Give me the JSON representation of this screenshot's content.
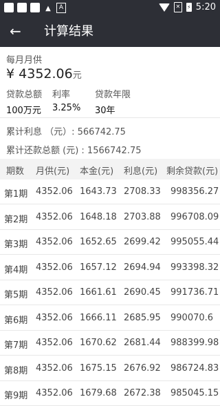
{
  "status": {
    "time": "5:20"
  },
  "appbar": {
    "title": "计算结果"
  },
  "summary": {
    "monthly_label": "每月月供",
    "monthly_currency": "¥",
    "monthly_value": "4352.06",
    "monthly_unit": "元",
    "loan_total_label": "贷款总额",
    "loan_total_value": "100万元",
    "rate_label": "利率",
    "rate_value": "3.25%",
    "years_label": "贷款年限",
    "years_value": "30年",
    "interest_line": "累计利息 （元）: 566742.75",
    "repay_line": "累计还款总额 (元) : 1566742.75"
  },
  "table": {
    "headers": [
      "期数",
      "月供(元)",
      "本金(元)",
      "利息(元)",
      "剩余贷款(元)"
    ],
    "rows": [
      [
        "第1期",
        "4352.06",
        "1643.73",
        "2708.33",
        "998356.27"
      ],
      [
        "第2期",
        "4352.06",
        "1648.18",
        "2703.88",
        "996708.09"
      ],
      [
        "第3期",
        "4352.06",
        "1652.65",
        "2699.42",
        "995055.44"
      ],
      [
        "第4期",
        "4352.06",
        "1657.12",
        "2694.94",
        "993398.32"
      ],
      [
        "第5期",
        "4352.06",
        "1661.61",
        "2690.45",
        "991736.71"
      ],
      [
        "第6期",
        "4352.06",
        "1666.11",
        "2685.95",
        "990070.6"
      ],
      [
        "第7期",
        "4352.06",
        "1670.62",
        "2681.44",
        "988399.98"
      ],
      [
        "第8期",
        "4352.06",
        "1675.15",
        "2676.92",
        "986724.83"
      ],
      [
        "第9期",
        "4352.06",
        "1679.68",
        "2672.38",
        "985045.15"
      ]
    ]
  }
}
